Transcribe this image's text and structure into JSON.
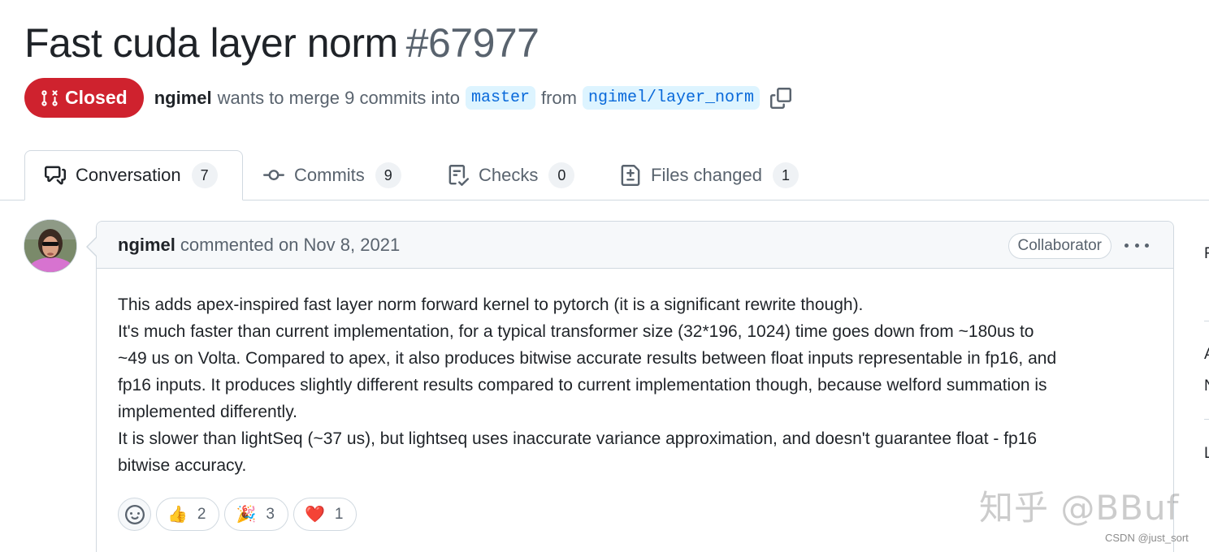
{
  "pr": {
    "title": "Fast cuda layer norm",
    "number": "#67977",
    "state": "Closed",
    "author": "ngimel",
    "merge_text": "wants to merge 9 commits into",
    "base_branch": "master",
    "from_text": "from",
    "head_branch": "ngimel/layer_norm"
  },
  "tabs": [
    {
      "label": "Conversation",
      "count": "7",
      "icon": "comment-discussion-icon",
      "active": true
    },
    {
      "label": "Commits",
      "count": "9",
      "icon": "git-commit-icon",
      "active": false
    },
    {
      "label": "Checks",
      "count": "0",
      "icon": "checklist-icon",
      "active": false
    },
    {
      "label": "Files changed",
      "count": "1",
      "icon": "file-diff-icon",
      "active": false
    }
  ],
  "comment": {
    "author": "ngimel",
    "meta": "commented on Nov 8, 2021",
    "role": "Collaborator",
    "body": [
      "This adds apex-inspired fast layer norm forward kernel to pytorch (it is a significant rewrite though).",
      "It's much faster than current implementation, for a typical transformer size (32*196, 1024) time goes down from ~180us to",
      "~49 us on Volta. Compared to apex, it also produces bitwise accurate results between float inputs representable in fp16, and",
      "fp16 inputs. It produces slightly different results compared to current implementation though, because welford summation is",
      "implemented differently.",
      "It is slower than lightSeq (~37 us), but lightseq uses inaccurate variance approximation, and doesn't guarantee float - fp16",
      "bitwise accuracy."
    ],
    "reactions": [
      {
        "emoji": "👍",
        "count": "2"
      },
      {
        "emoji": "🎉",
        "count": "3"
      },
      {
        "emoji": "❤️",
        "count": "1"
      }
    ]
  },
  "watermark": {
    "main": "知乎 @BBuf",
    "small": "CSDN @just_sort"
  },
  "sidebar_partial": [
    "F",
    "A",
    "N",
    "L"
  ],
  "colors": {
    "closed": "#cf222e",
    "link": "#0969da",
    "branch_bg": "#ddf4ff",
    "border": "#d1d9e0",
    "muted": "#59636e"
  }
}
